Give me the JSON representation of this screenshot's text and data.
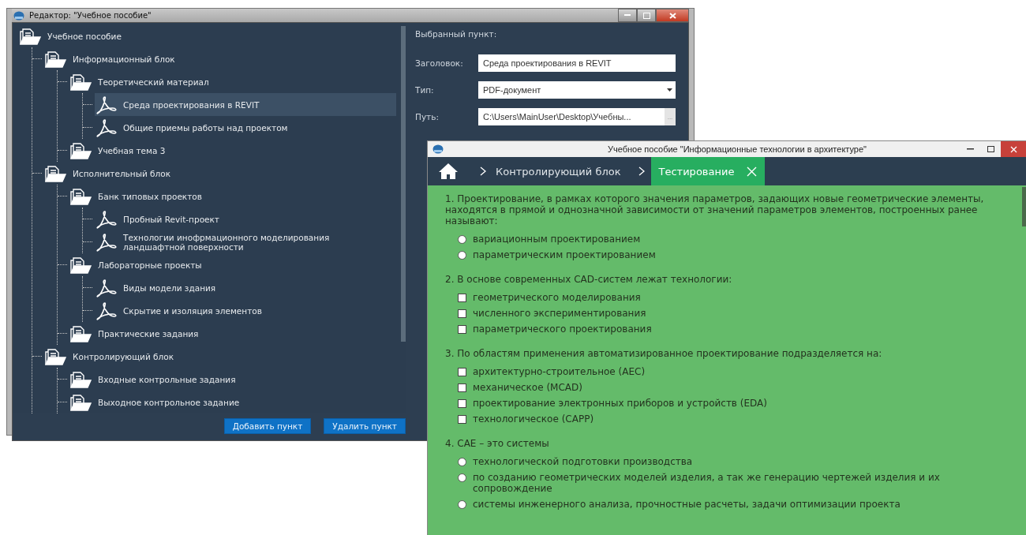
{
  "editor_window": {
    "title": "Редактор: \"Учебное пособие\"",
    "tree": [
      {
        "label": "Учебное пособие",
        "kind": "folder",
        "selected": false,
        "children": [
          {
            "label": "Информационный блок",
            "kind": "folder",
            "selected": false,
            "children": [
              {
                "label": "Теоретический материал",
                "kind": "folder",
                "selected": false,
                "children": [
                  {
                    "label": "Среда проектирования в REVIT",
                    "kind": "pdf",
                    "selected": true
                  },
                  {
                    "label": "Общие приемы работы над проектом",
                    "kind": "pdf",
                    "selected": false
                  }
                ]
              },
              {
                "label": "Учебная тема 3",
                "kind": "folder",
                "selected": false
              }
            ]
          },
          {
            "label": "Исполнительный блок",
            "kind": "folder",
            "selected": false,
            "children": [
              {
                "label": "Банк типовых проектов",
                "kind": "folder",
                "selected": false,
                "children": [
                  {
                    "label": "Пробный Revit-проект",
                    "kind": "pdf",
                    "selected": false
                  },
                  {
                    "label": "Технологии инофрмационного моделирования ландшафтной поверхности",
                    "kind": "pdf",
                    "selected": false
                  }
                ]
              },
              {
                "label": "Лабораторные проекты",
                "kind": "folder",
                "selected": false,
                "children": [
                  {
                    "label": "Виды модели здания",
                    "kind": "pdf",
                    "selected": false
                  },
                  {
                    "label": "Скрытие и изоляция элементов",
                    "kind": "pdf",
                    "selected": false
                  }
                ]
              },
              {
                "label": "Практические задания",
                "kind": "folder",
                "selected": false
              }
            ]
          },
          {
            "label": "Контролирующий блок",
            "kind": "folder",
            "selected": false,
            "children": [
              {
                "label": "Входные контрольные задания",
                "kind": "folder",
                "selected": false
              },
              {
                "label": "Выходное контрольное задание",
                "kind": "folder",
                "selected": false
              }
            ]
          }
        ]
      }
    ],
    "buttons": [
      "Добавить пункт",
      "Удалить пункт"
    ],
    "details": {
      "heading": "Выбранный пункт:",
      "fields": [
        {
          "label": "Заголовок:",
          "kind": "text",
          "value": "Среда проектирования в REVIT"
        },
        {
          "label": "Тип:",
          "kind": "select",
          "value": "PDF-документ"
        },
        {
          "label": "Путь:",
          "kind": "browse",
          "value": "C:\\Users\\MainUser\\Desktop\\Учебны...",
          "button": "..."
        }
      ]
    }
  },
  "viewer_window": {
    "title": "Учебное пособие \"Информационные технологии в архитектуре\"",
    "breadcrumbs": [
      {
        "label": "Контролирующий блок",
        "selected": false
      },
      {
        "label": "Тестирование",
        "selected": true
      }
    ],
    "questions": [
      {
        "text": "1. Проектирование, в рамках которого значения параметров, задающих новые геометрические элементы, находятся в прямой и однозначной зависимости от значений параметров элементов, построенных ранее называют:",
        "kind": "radio",
        "options": [
          {
            "label": "вариационным проектированием",
            "checked": false
          },
          {
            "label": "параметрическим проектированием",
            "checked": false
          }
        ]
      },
      {
        "text": "2. В основе современных CAD-систем лежат технологии:",
        "kind": "checkbox",
        "options": [
          {
            "label": "геометрического моделирования",
            "checked": false
          },
          {
            "label": "численного экспериментирования",
            "checked": false
          },
          {
            "label": "параметрического проектирования",
            "checked": false
          }
        ]
      },
      {
        "text": "3. По областям применения автоматизированное проектирование подразделяется на:",
        "kind": "checkbox",
        "options": [
          {
            "label": "архитектурно-строительное (AEC)",
            "checked": false
          },
          {
            "label": "механическое (MCAD)",
            "checked": false
          },
          {
            "label": "проектирование электронных приборов и устройств (EDA)",
            "checked": false
          },
          {
            "label": "технологическое (CAPP)",
            "checked": false
          }
        ]
      },
      {
        "text": "4. CAE – это системы",
        "kind": "radio",
        "options": [
          {
            "label": "технологической подготовки производства",
            "checked": false
          },
          {
            "label": "по созданию геометрических моделей изделия, а так же генерацию чертежей изделия и их сопровождение",
            "checked": false
          },
          {
            "label": "системы инженерного анализа, прочностные расчеты, задачи оптимизации проекта",
            "checked": false
          }
        ]
      }
    ]
  }
}
